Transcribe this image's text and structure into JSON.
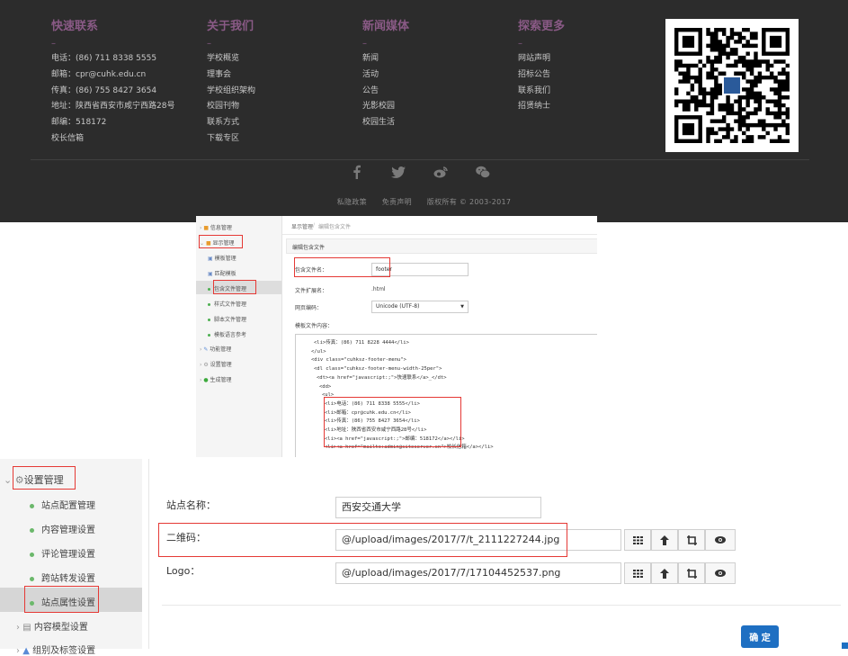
{
  "footer": {
    "columns": [
      {
        "title": "快速联系",
        "items": [
          "电话：(86) 711 8338 5555",
          "邮箱：cpr@cuhk.edu.cn",
          "传真：(86) 755 8427 3654",
          "地址：陕西省西安市咸宁西路28号",
          "邮编：518172",
          "校长信箱"
        ]
      },
      {
        "title": "关于我们",
        "items": [
          "学校概览",
          "理事会",
          "学校组织架构",
          "校园刊物",
          "联系方式",
          "下载专区"
        ]
      },
      {
        "title": "新闻媒体",
        "items": [
          "新闻",
          "活动",
          "公告",
          "光影校园",
          "校园生活"
        ]
      },
      {
        "title": "探索更多",
        "items": [
          "网站声明",
          "招标公告",
          "联系我们",
          "招贤纳士"
        ]
      }
    ],
    "dash": "–",
    "social_icons": [
      "facebook-icon",
      "twitter-icon",
      "weibo-icon",
      "wechat-icon"
    ],
    "bottom_links": [
      "私隐政策",
      "免责声明",
      "版权所有 © 2003-2017"
    ],
    "colors": {
      "background": "#2c2c2c",
      "heading": "#8a5a86",
      "text": "#c8c8c8"
    }
  },
  "editor": {
    "sidebar": [
      {
        "label": "信息管理",
        "type": "group"
      },
      {
        "label": "显示管理",
        "type": "group"
      },
      {
        "label": "模板管理",
        "type": "item"
      },
      {
        "label": "匹配模板",
        "type": "item"
      },
      {
        "label": "包含文件管理",
        "type": "item"
      },
      {
        "label": "样式文件管理",
        "type": "item"
      },
      {
        "label": "脚本文件管理",
        "type": "item"
      },
      {
        "label": "模板语言参考",
        "type": "item"
      },
      {
        "label": "功能管理",
        "type": "group"
      },
      {
        "label": "设置管理",
        "type": "group"
      },
      {
        "label": "生成管理",
        "type": "group"
      }
    ],
    "breadcrumb": [
      "显示管理",
      "编辑包含文件"
    ],
    "panel_title": "编辑包含文件",
    "form": {
      "filename_label": "包含文件名：",
      "filename_value": "footer",
      "ext_label": "文件扩展名：",
      "ext_value": ".html",
      "encoding_label": "网页编码：",
      "encoding_value": "Unicode (UTF-8)",
      "content_label": "模板文件内容："
    },
    "code_lines": [
      "<li>传真：(86) 711 8228 4444</li>",
      "</ul>",
      "<div class=\"cuhksz-footer-menu\">",
      "<dl class=\"cuhksz-footer-menu-width-25per\">",
      "<dt><a href=\"javascript:;\">快速联系</a>_</dt>",
      "<dd>",
      "<ul>",
      "<li>电话：(86) 711 8338 5555</li>",
      "<li>邮箱：cpr@cuhk.edu.cn</li>",
      "<li>传真：(86) 755 8427 3654</li>",
      "<li>地址：陕西省西安市咸宁西路28号</li>",
      "<li><a href=\"javascript:;\">邮编：518172</a></li>",
      "<li><a href=\"mailto:admin@siteserver.cn\">校长信箱</a></li>"
    ]
  },
  "settings": {
    "sidebar": [
      {
        "label": "设置管理",
        "type": "group"
      },
      {
        "label": "站点配置管理",
        "type": "item"
      },
      {
        "label": "内容管理设置",
        "type": "item"
      },
      {
        "label": "评论管理设置",
        "type": "item"
      },
      {
        "label": "跨站转发设置",
        "type": "item"
      },
      {
        "label": "站点属性设置",
        "type": "item"
      },
      {
        "label": "内容模型设置",
        "type": "group"
      },
      {
        "label": "组别及标签设置",
        "type": "group"
      }
    ],
    "site_name_label": "站点名称：",
    "site_name_value": "西安交通大学",
    "qrcode_label": "二维码：",
    "qrcode_value": "@/upload/images/2017/7/t_2111227244.jpg",
    "logo_label": "Logo：",
    "logo_value": "@/upload/images/2017/7/17104452537.png",
    "confirm_label": "确 定",
    "accent": "#1e6fc2",
    "highlight": "#e53935"
  }
}
